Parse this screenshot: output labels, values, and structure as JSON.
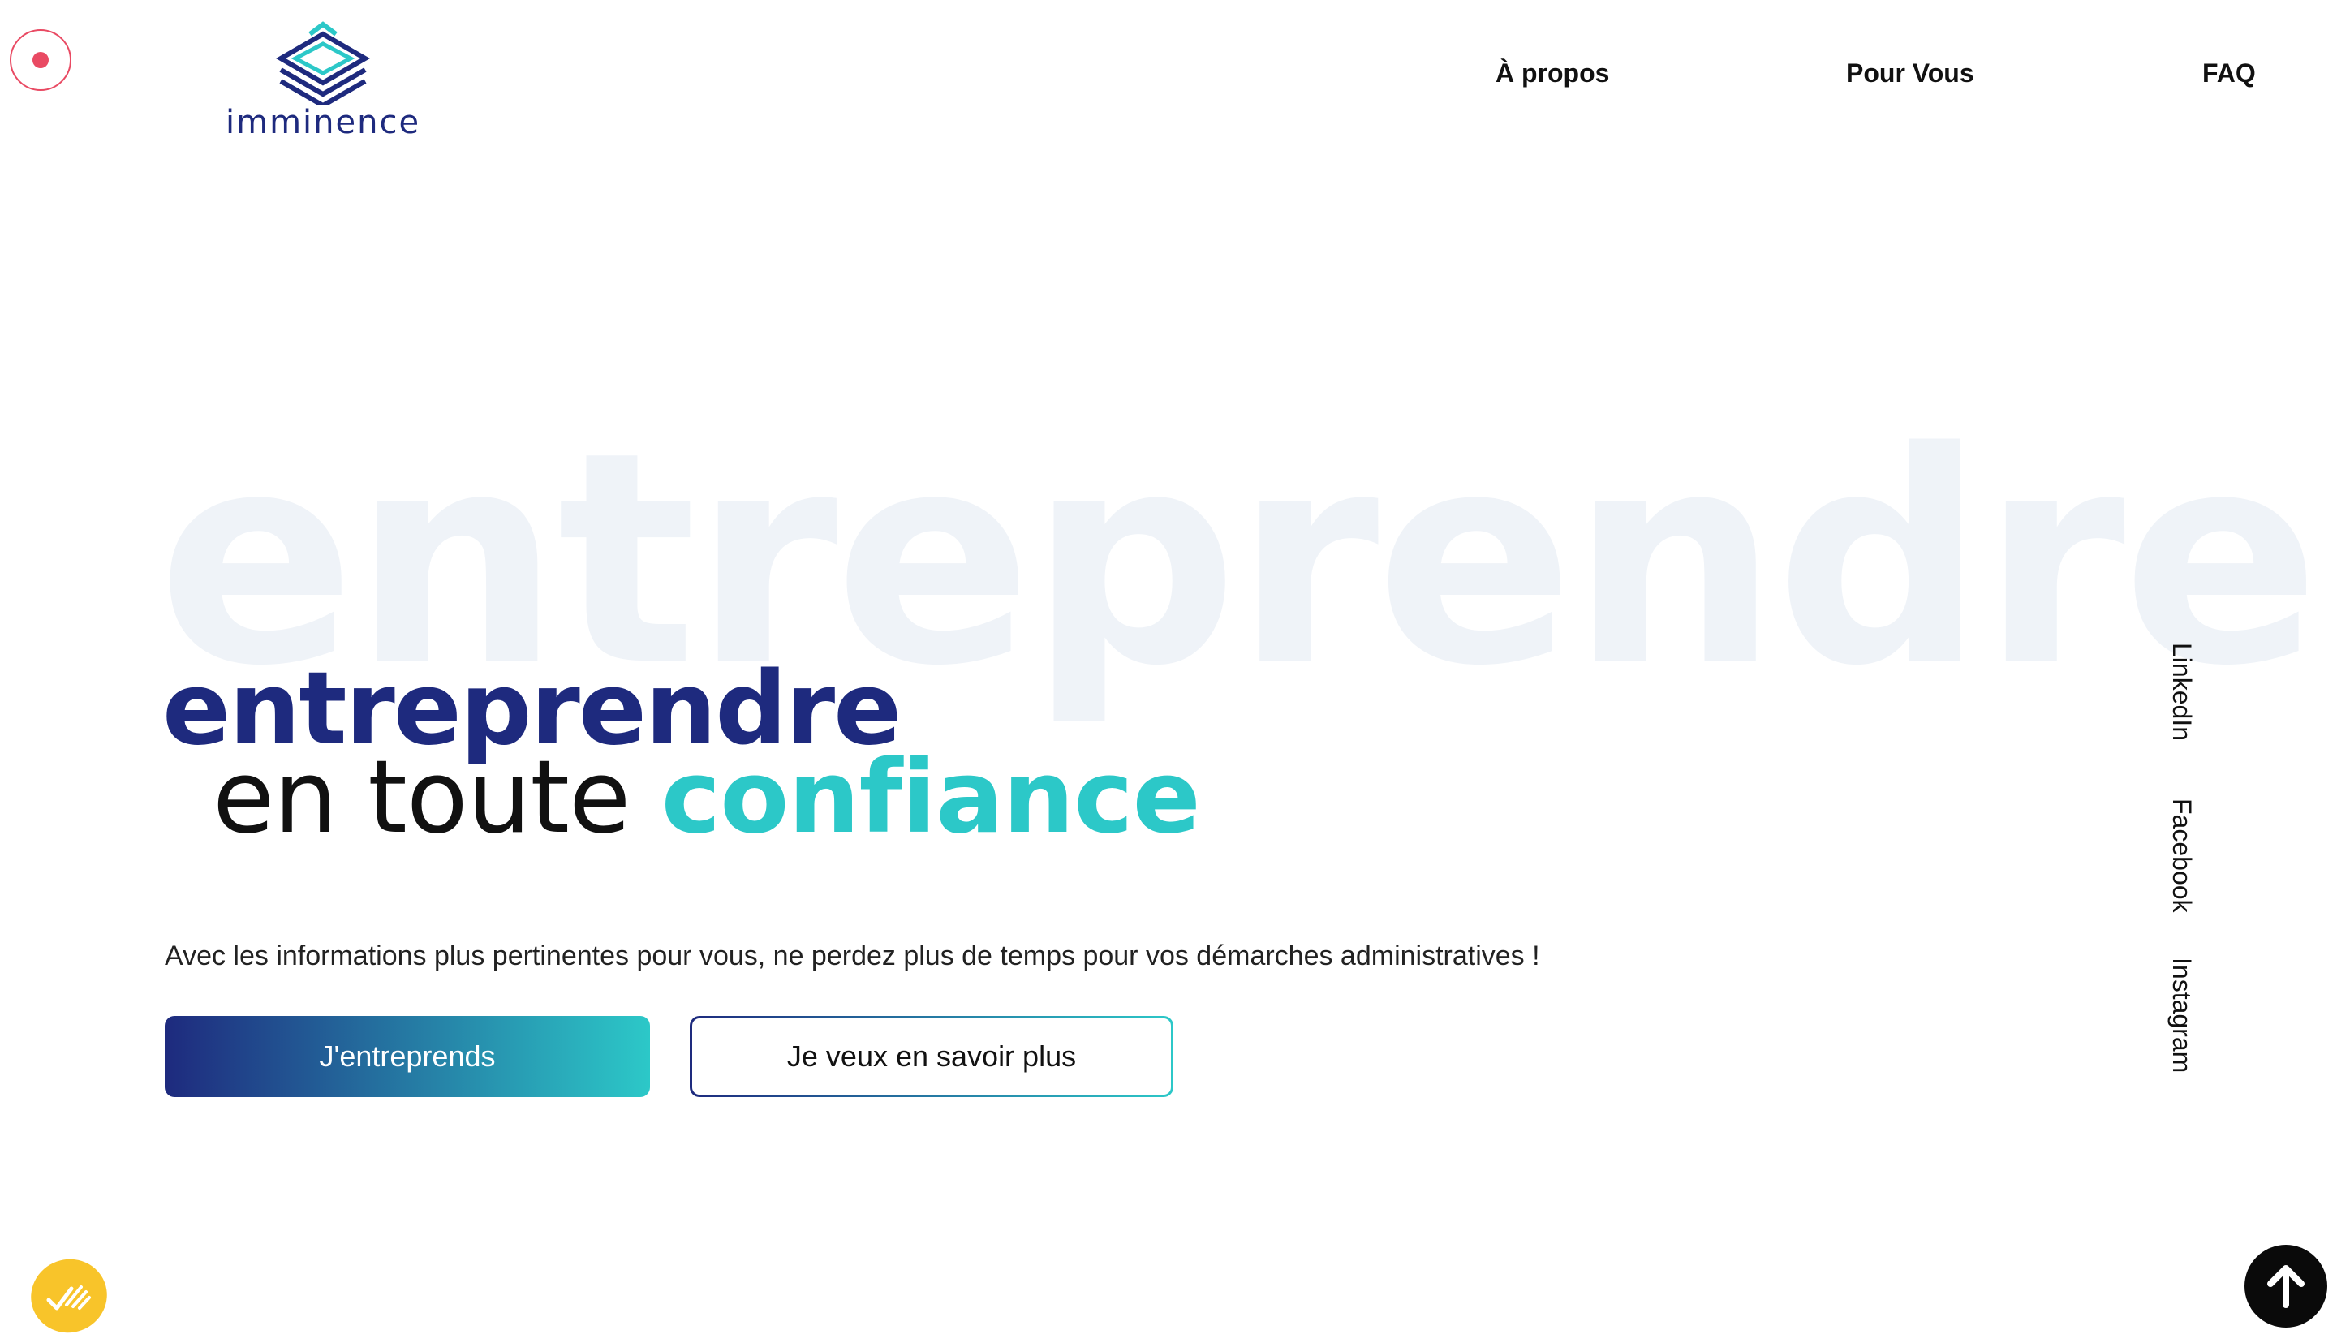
{
  "recorder": {
    "icon": "record-icon",
    "color": "#e94a63"
  },
  "logo": {
    "text": "imminence",
    "icon": "layers-logo-icon",
    "primary_color": "#1e2a7e",
    "accent_color": "#2cc8c8"
  },
  "nav": {
    "items": [
      {
        "label": "À propos"
      },
      {
        "label": "Pour Vous"
      },
      {
        "label": "FAQ"
      }
    ]
  },
  "hero": {
    "background_word": "entreprendre",
    "headline_line1": "entreprendre",
    "headline_line2_plain": "en toute ",
    "headline_line2_accent": "confiance",
    "subtitle": "Avec les informations plus pertinentes pour vous, ne perdez plus de temps pour vos démarches administratives !",
    "primary_button": "J'entreprends",
    "secondary_button": "Je veux en savoir plus"
  },
  "social": {
    "links": [
      {
        "label": "LinkedIn"
      },
      {
        "label": "Facebook"
      },
      {
        "label": "Instagram"
      }
    ]
  },
  "widgets": {
    "chat_icon": "chat-check-icon",
    "chat_color": "#f8c42a",
    "scroll_top_icon": "arrow-up-icon"
  },
  "colors": {
    "brand_dark": "#1e2a7e",
    "brand_teal": "#2cc8c8",
    "background_word": "#eff3f8"
  }
}
